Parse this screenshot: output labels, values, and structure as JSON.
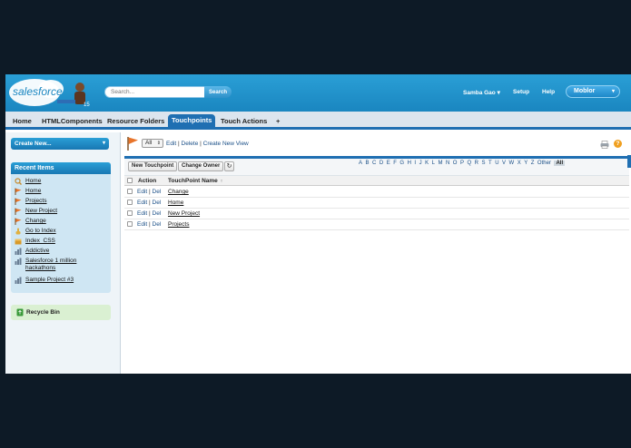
{
  "header": {
    "logo_text": "salesforce",
    "search_placeholder": "Search...",
    "search_button": "Search",
    "user_menu": "Samba Gao",
    "setup": "Setup",
    "help": "Help",
    "app_picker": "Moblor"
  },
  "tabs": [
    {
      "label": "Home",
      "active": false
    },
    {
      "label": "HTMLComponents",
      "active": false
    },
    {
      "label": "Resource Folders",
      "active": false
    },
    {
      "label": "Touchpoints",
      "active": true
    },
    {
      "label": "Touch Actions",
      "active": false
    },
    {
      "label": "+",
      "active": false
    }
  ],
  "sidebar": {
    "create_new": "Create New...",
    "recent_title": "Recent Items",
    "recent_items": [
      {
        "label": "Home",
        "icon": "magnifier-icon"
      },
      {
        "label": "Home",
        "icon": "flag-icon"
      },
      {
        "label": "Projects",
        "icon": "flag-icon"
      },
      {
        "label": "New Project",
        "icon": "flag-icon"
      },
      {
        "label": "Change",
        "icon": "flag-icon"
      },
      {
        "label": "Go to Index",
        "icon": "hand-icon"
      },
      {
        "label": "Index_CSS",
        "icon": "box-icon"
      },
      {
        "label": "Addictive",
        "icon": "chart-icon"
      },
      {
        "label": "Salesforce 1 million hackathons",
        "icon": "chart-icon"
      },
      {
        "label": "Sample Project #3",
        "icon": "chart-icon"
      }
    ],
    "recycle_bin": "Recycle Bin"
  },
  "main": {
    "view_value": "All",
    "view_links": {
      "edit": "Edit",
      "delete": "Delete",
      "create": "Create New View",
      "sep": "|"
    },
    "buttons": {
      "new_touchpoint": "New Touchpoint",
      "change_owner": "Change Owner",
      "refresh": "↻"
    },
    "alphabet": [
      "A",
      "B",
      "C",
      "D",
      "E",
      "F",
      "G",
      "H",
      "I",
      "J",
      "K",
      "L",
      "M",
      "N",
      "O",
      "P",
      "Q",
      "R",
      "S",
      "T",
      "U",
      "V",
      "W",
      "X",
      "Y",
      "Z",
      "Other"
    ],
    "alphabet_all": "All",
    "columns": {
      "action": "Action",
      "name": "TouchPoint Name",
      "sort": "↑"
    },
    "rows": [
      {
        "edit": "Edit",
        "del": "Del",
        "name": "Change"
      },
      {
        "edit": "Edit",
        "del": "Del",
        "name": "Home"
      },
      {
        "edit": "Edit",
        "del": "Del",
        "name": "New Project"
      },
      {
        "edit": "Edit",
        "del": "Del",
        "name": "Projects"
      }
    ],
    "row_sep": "|",
    "help_glyph": "?"
  },
  "colors": {
    "brand_blue": "#1f6fb2",
    "header_blue": "#2a9fd6",
    "link_blue": "#1a4f87",
    "flag_orange": "#e8742a"
  }
}
